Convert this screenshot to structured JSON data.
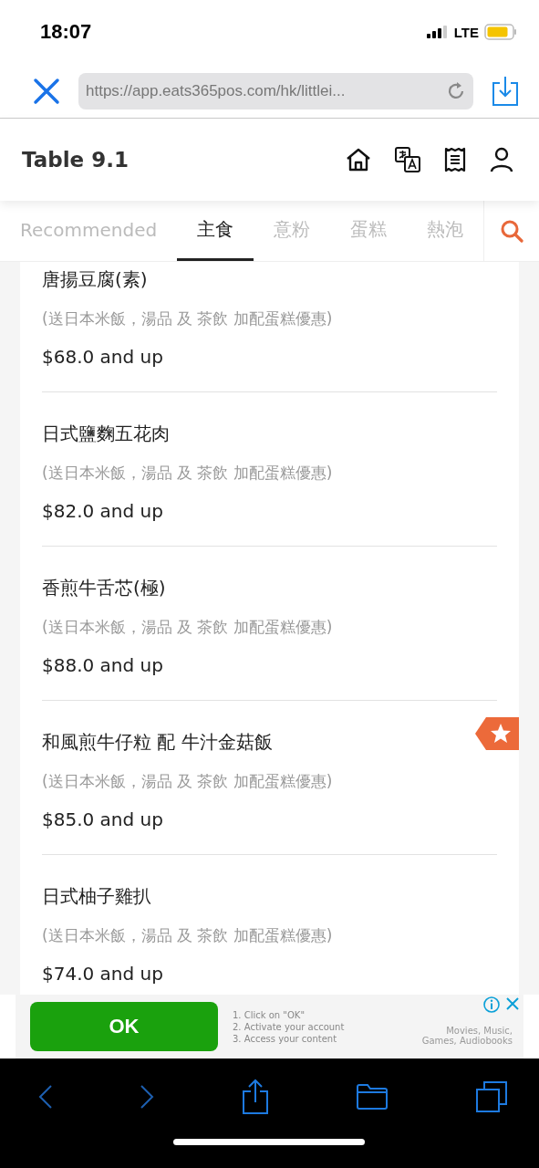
{
  "status_bar": {
    "time": "18:07",
    "network": "LTE"
  },
  "browser": {
    "url": "https://app.eats365pos.com/hk/littlei..."
  },
  "header": {
    "title": "Table 9.1"
  },
  "tabs": [
    {
      "label": "Recommended",
      "selected": false
    },
    {
      "label": "主食",
      "selected": true
    },
    {
      "label": "意粉",
      "selected": false
    },
    {
      "label": "蛋糕",
      "selected": false
    },
    {
      "label": "熱泡",
      "selected": false
    }
  ],
  "menu_items": [
    {
      "name": "唐揚豆腐(素)",
      "note": "(送日本米飯，湯品 及 茶飲 加配蛋糕優惠)",
      "price": "$68.0 and up",
      "featured": false
    },
    {
      "name": "日式鹽麴五花肉",
      "note": "(送日本米飯，湯品 及 茶飲 加配蛋糕優惠)",
      "price": "$82.0 and up",
      "featured": false
    },
    {
      "name": "香煎牛舌芯(極)",
      "note": "(送日本米飯，湯品 及 茶飲 加配蛋糕優惠)",
      "price": "$88.0 and up",
      "featured": false
    },
    {
      "name": "和風煎牛仔粒 配 牛汁金菇飯",
      "note": "(送日本米飯，湯品 及 茶飲 加配蛋糕優惠)",
      "price": "$85.0 and up",
      "featured": true
    },
    {
      "name": "日式柚子雞扒",
      "note": "(送日本米飯，湯品 及 茶飲 加配蛋糕優惠)",
      "price": "$74.0 and up",
      "featured": false
    }
  ],
  "ad": {
    "button": "OK",
    "steps": [
      "1. Click on \"OK\"",
      "2. Activate your account",
      "3. Access your content"
    ],
    "tagline": "Movies, Music, Games, Audiobooks"
  }
}
